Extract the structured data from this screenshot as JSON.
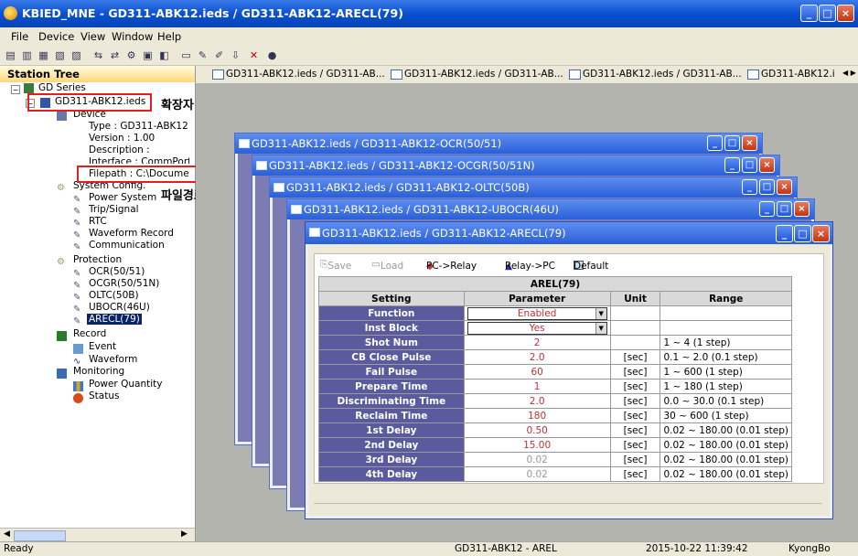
{
  "window": {
    "title": "KBIED_MNE - GD311-ABK12.ieds / GD311-ABK12-ARECL(79)"
  },
  "menu": [
    "File",
    "Device",
    "View",
    "Window",
    "Help"
  ],
  "tree": {
    "header": "Station Tree",
    "root": "GD Series",
    "file": "GD311-ABK12.ieds",
    "device": "Device",
    "type": "Type : GD311-ABK12",
    "version": "Version : 1.00",
    "description": "Description :",
    "interface": "Interface : CommPort",
    "filepath": "Filepath : C:\\Docume",
    "sysconfig": "System Config.",
    "sys_items": [
      "Power System",
      "Trip/Signal",
      "RTC",
      "Waveform Record",
      "Communication"
    ],
    "protection": "Protection",
    "prot_items": [
      "OCR(50/51)",
      "OCGR(50/51N)",
      "OLTC(50B)",
      "UBOCR(46U)",
      "ARECL(79)"
    ],
    "record": "Record",
    "rec_items": [
      "Event",
      "Waveform"
    ],
    "monitoring": "Monitoring",
    "mon_items": [
      "Power Quantity",
      "Status"
    ]
  },
  "annotations": {
    "ext": "확장자",
    "path": "파일경로"
  },
  "tabs": [
    "GD311-ABK12.ieds / GD311-AB...",
    "GD311-ABK12.ieds / GD311-AB...",
    "GD311-ABK12.ieds / GD311-AB...",
    "GD311-ABK12.i"
  ],
  "children": [
    "GD311-ABK12.ieds / GD311-ABK12-OCR(50/51)",
    "GD311-ABK12.ieds / GD311-ABK12-OCGR(50/51N)",
    "GD311-ABK12.ieds / GD311-ABK12-OLTC(50B)",
    "GD311-ABK12.ieds / GD311-ABK12-UBOCR(46U)",
    "GD311-ABK12.ieds / GD311-ABK12-ARECL(79)"
  ],
  "buttons": {
    "save": "Save",
    "load": "Load",
    "pc_relay": "PC->Relay",
    "relay_pc": "Relay->PC",
    "default": "Default"
  },
  "grid": {
    "title": "AREL(79)",
    "headers": [
      "Setting",
      "Parameter",
      "Unit",
      "Range"
    ],
    "rows": [
      {
        "setting": "Function",
        "param": "Enabled",
        "unit": "",
        "range": ""
      },
      {
        "setting": "Inst Block",
        "param": "Yes",
        "unit": "",
        "range": ""
      },
      {
        "setting": "Shot Num",
        "param": "2",
        "unit": "",
        "range": "1 ~ 4 (1 step)"
      },
      {
        "setting": "CB Close Pulse",
        "param": "2.0",
        "unit": "[sec]",
        "range": "0.1 ~ 2.0 (0.1 step)"
      },
      {
        "setting": "Fail Pulse",
        "param": "60",
        "unit": "[sec]",
        "range": "1 ~ 600 (1 step)"
      },
      {
        "setting": "Prepare Time",
        "param": "1",
        "unit": "[sec]",
        "range": "1 ~ 180 (1 step)"
      },
      {
        "setting": "Discriminating Time",
        "param": "2.0",
        "unit": "[sec]",
        "range": "0.0 ~ 30.0 (0.1 step)"
      },
      {
        "setting": "Reclaim Time",
        "param": "180",
        "unit": "[sec]",
        "range": "30 ~ 600 (1 step)"
      },
      {
        "setting": "1st Delay",
        "param": "0.50",
        "unit": "[sec]",
        "range": "0.02 ~ 180.00 (0.01 step)"
      },
      {
        "setting": "2nd Delay",
        "param": "15.00",
        "unit": "[sec]",
        "range": "0.02 ~ 180.00 (0.01 step)"
      },
      {
        "setting": "3rd Delay",
        "param": "0.02",
        "unit": "[sec]",
        "range": "0.02 ~ 180.00 (0.01 step)"
      },
      {
        "setting": "4th Delay",
        "param": "0.02",
        "unit": "[sec]",
        "range": "0.02 ~ 180.00 (0.01 step)"
      }
    ]
  },
  "status": {
    "left": "Ready",
    "device": "GD311-ABK12 - AREL",
    "time": "2015-10-22 11:39:42",
    "user": "KyongBo"
  }
}
